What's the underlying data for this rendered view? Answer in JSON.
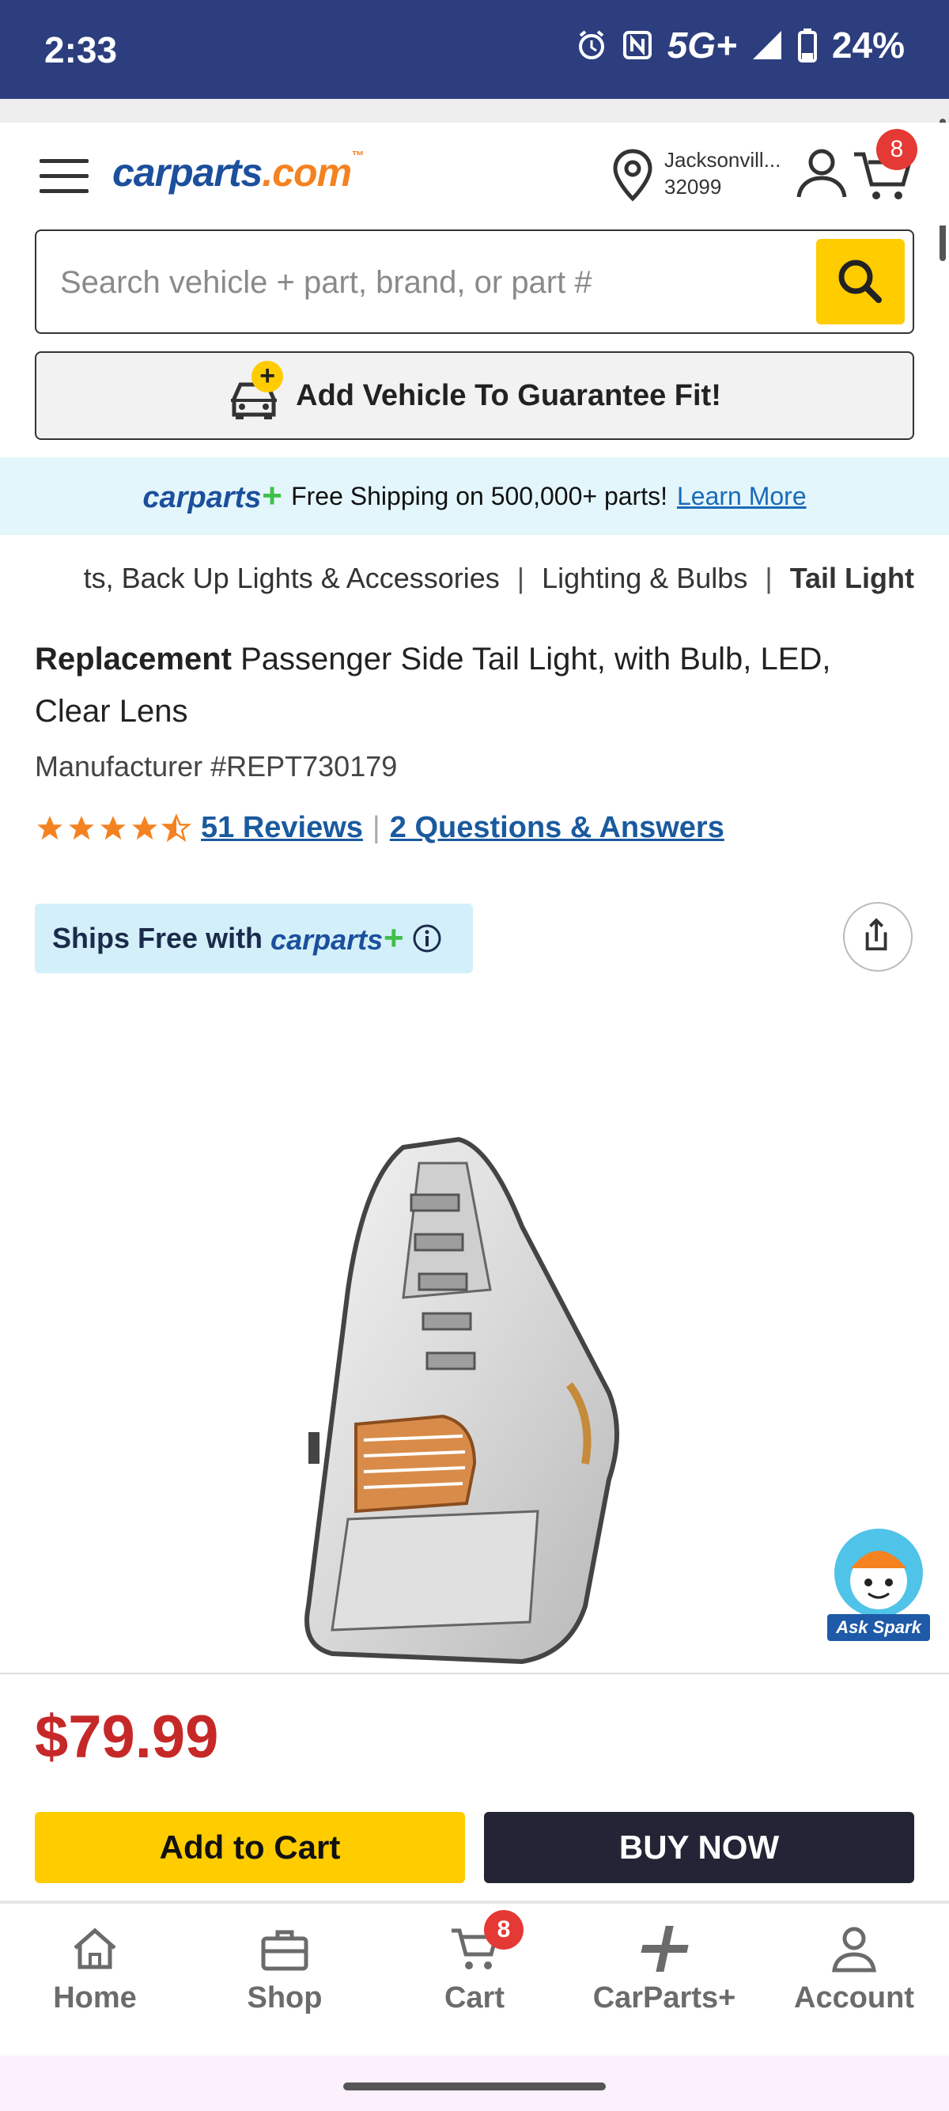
{
  "status_bar": {
    "time": "2:33",
    "network": "5G+",
    "battery": "24%"
  },
  "header": {
    "logo_main": "carparts",
    "logo_suffix": ".com",
    "location_city": "Jacksonvill...",
    "location_zip": "32099",
    "cart_count": "8"
  },
  "search": {
    "placeholder": "Search vehicle + part, brand, or part #"
  },
  "add_vehicle": {
    "label": "Add Vehicle To Guarantee Fit!"
  },
  "shipping_banner": {
    "brand": "carparts",
    "text": "Free Shipping on 500,000+ parts!",
    "link": "Learn More"
  },
  "breadcrumb": {
    "items": [
      "ts, Back Up Lights & Accessories",
      "Lighting & Bulbs",
      "Tail Light"
    ],
    "separator": "|"
  },
  "product": {
    "brand": "Replacement",
    "title": "Passenger Side Tail Light, with Bulb, LED, Clear Lens",
    "manufacturer": "Manufacturer #REPT730179",
    "rating": 4.5,
    "reviews": "51 Reviews",
    "qa": "2 Questions & Answers",
    "ships_free_text": "Ships Free with",
    "ships_free_brand": "carparts",
    "price": "$79.99"
  },
  "spark": {
    "label": "Ask Spark"
  },
  "actions": {
    "add_to_cart": "Add to Cart",
    "buy_now": "BUY NOW"
  },
  "bottom_nav": {
    "items": [
      {
        "label": "Home",
        "icon": "home-icon"
      },
      {
        "label": "Shop",
        "icon": "toolbox-icon"
      },
      {
        "label": "Cart",
        "icon": "cart-icon",
        "badge": "8"
      },
      {
        "label": "CarParts+",
        "icon": "carparts-plus-icon"
      },
      {
        "label": "Account",
        "icon": "account-icon"
      }
    ]
  },
  "colors": {
    "status_bar": "#2c3e7e",
    "brand_blue": "#1c4f9c",
    "accent_yellow": "#ffcc00",
    "price_red": "#c62828",
    "badge_red": "#e53935",
    "banner_bg": "#e3f6fb"
  }
}
